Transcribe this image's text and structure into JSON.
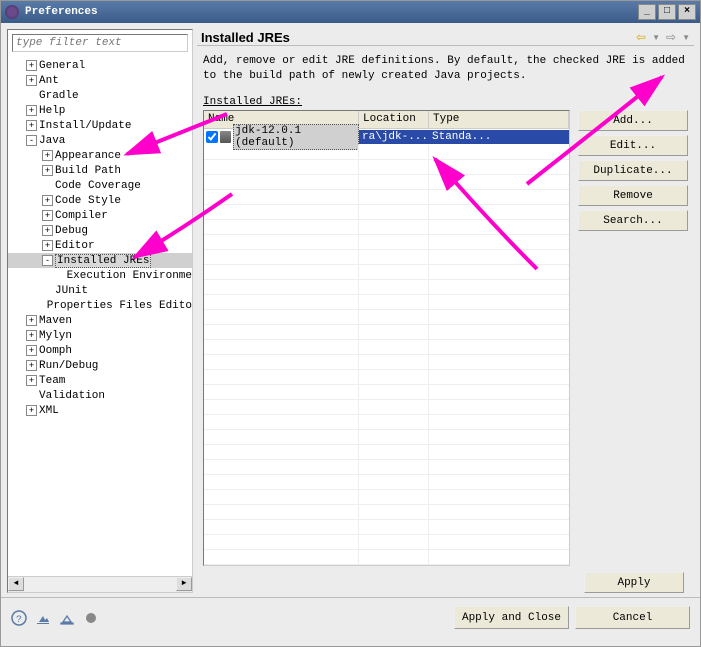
{
  "window": {
    "title": "Preferences",
    "buttons": {
      "min": "_",
      "max": "□",
      "close": "×"
    }
  },
  "filter_placeholder": "type filter text",
  "tree": [
    {
      "label": "General",
      "level": 1,
      "exp": "+"
    },
    {
      "label": "Ant",
      "level": 1,
      "exp": "+"
    },
    {
      "label": "Gradle",
      "level": 1,
      "exp": ""
    },
    {
      "label": "Help",
      "level": 1,
      "exp": "+"
    },
    {
      "label": "Install/Update",
      "level": 1,
      "exp": "+"
    },
    {
      "label": "Java",
      "level": 1,
      "exp": "-"
    },
    {
      "label": "Appearance",
      "level": 2,
      "exp": "+"
    },
    {
      "label": "Build Path",
      "level": 2,
      "exp": "+"
    },
    {
      "label": "Code Coverage",
      "level": 2,
      "exp": ""
    },
    {
      "label": "Code Style",
      "level": 2,
      "exp": "+"
    },
    {
      "label": "Compiler",
      "level": 2,
      "exp": "+"
    },
    {
      "label": "Debug",
      "level": 2,
      "exp": "+"
    },
    {
      "label": "Editor",
      "level": 2,
      "exp": "+"
    },
    {
      "label": "Installed JREs",
      "level": 2,
      "exp": "-",
      "selected": true
    },
    {
      "label": "Execution Environme",
      "level": 3,
      "exp": ""
    },
    {
      "label": "JUnit",
      "level": 2,
      "exp": ""
    },
    {
      "label": "Properties Files Edito",
      "level": 2,
      "exp": ""
    },
    {
      "label": "Maven",
      "level": 1,
      "exp": "+"
    },
    {
      "label": "Mylyn",
      "level": 1,
      "exp": "+"
    },
    {
      "label": "Oomph",
      "level": 1,
      "exp": "+"
    },
    {
      "label": "Run/Debug",
      "level": 1,
      "exp": "+"
    },
    {
      "label": "Team",
      "level": 1,
      "exp": "+"
    },
    {
      "label": "Validation",
      "level": 1,
      "exp": ""
    },
    {
      "label": "XML",
      "level": 1,
      "exp": "+"
    }
  ],
  "page": {
    "title": "Installed JREs",
    "description": "Add, remove or edit JRE definitions. By default, the checked JRE is added to the build path of newly created Java projects.",
    "table_label": "Installed JREs:",
    "columns": {
      "name": "Name",
      "location": "Location",
      "type": "Type"
    },
    "rows": [
      {
        "checked": true,
        "name": "jdk-12.0.1 (default)",
        "location": "ra\\jdk-...",
        "type": "Standa..."
      }
    ]
  },
  "buttons": {
    "add": "Add...",
    "edit": "Edit...",
    "duplicate": "Duplicate...",
    "remove": "Remove",
    "search": "Search...",
    "apply": "Apply",
    "apply_close": "Apply and Close",
    "cancel": "Cancel"
  },
  "nav": {
    "back": "⇦",
    "fwd": "⇨"
  }
}
